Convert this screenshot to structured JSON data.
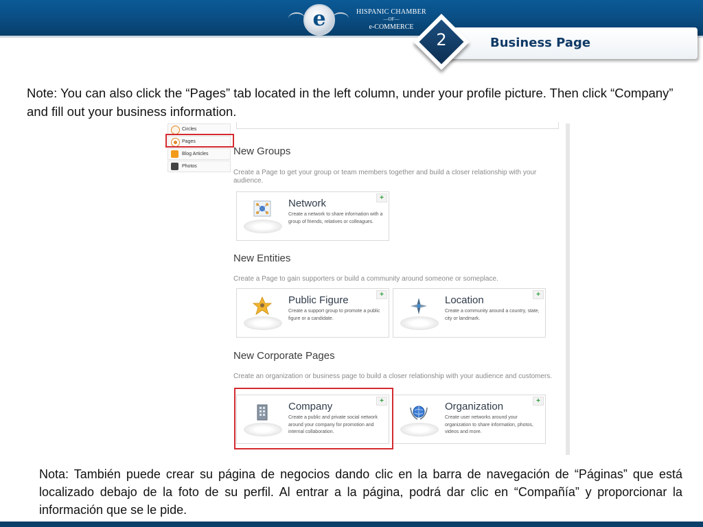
{
  "header": {
    "logo": {
      "emblem_letter": "e",
      "line1": "HISPANIC CHAMBER",
      "line2": "—OF—",
      "line3": "e-COMMERCE"
    },
    "step_number": "2",
    "step_title": "Business Page"
  },
  "note_en": "Note: You can also click the “Pages” tab located in the left column, under your profile picture. Then click “Company” and fill out your business information.",
  "screenshot": {
    "side_menu": [
      {
        "label": "Circles",
        "icon": "circles-icon",
        "color": "#e08a2a"
      },
      {
        "label": "Pages",
        "icon": "pages-icon",
        "color": "#e08a2a"
      },
      {
        "label": "Blog Articles",
        "icon": "blog-articles-icon",
        "color": "#f29a1a"
      },
      {
        "label": "Photos",
        "icon": "camera-icon",
        "color": "#444444"
      }
    ],
    "sections": [
      {
        "title": "New Groups",
        "desc": "Create a Page to get your group or team members together and build a closer relationship with your audience."
      },
      {
        "title": "New Entities",
        "desc": "Create a Page to gain supporters or build a community around someone or someplace."
      },
      {
        "title": "New Corporate Pages",
        "desc": "Create an organization or business page to build a closer relationship with your audience and customers."
      }
    ],
    "cards": [
      {
        "title": "Network",
        "desc": "Create a network to share information with a group of friends, relatives or colleagues.",
        "icon": "network-icon",
        "plus": "+"
      },
      {
        "title": "Public Figure",
        "desc": "Create a support group to promote a public figure or a candidate.",
        "icon": "star-person-icon",
        "plus": "+"
      },
      {
        "title": "Location",
        "desc": "Create a community around a country, state, city or landmark.",
        "icon": "compass-icon",
        "plus": "+"
      },
      {
        "title": "Company",
        "desc": "Create a public and private social network around your company for promotion and internal collaboration.",
        "icon": "building-icon",
        "plus": "+"
      },
      {
        "title": "Organization",
        "desc": "Create user networks around your organization to share information, photos, videos and more.",
        "icon": "globe-laurel-icon",
        "plus": "+"
      }
    ]
  },
  "note_es": "Nota: También puede crear su página de negocios dando clic en la barra de navegación de “Páginas” que está localizado debajo de la foto de su perfil. Al entrar a la página, podrá dar clic en “Compañía” y proporcionar la información que se le pide.",
  "colors": {
    "header_blue": "#0a4f86",
    "highlight_red": "#d42a2f",
    "plus_green": "#2e9c3a"
  }
}
